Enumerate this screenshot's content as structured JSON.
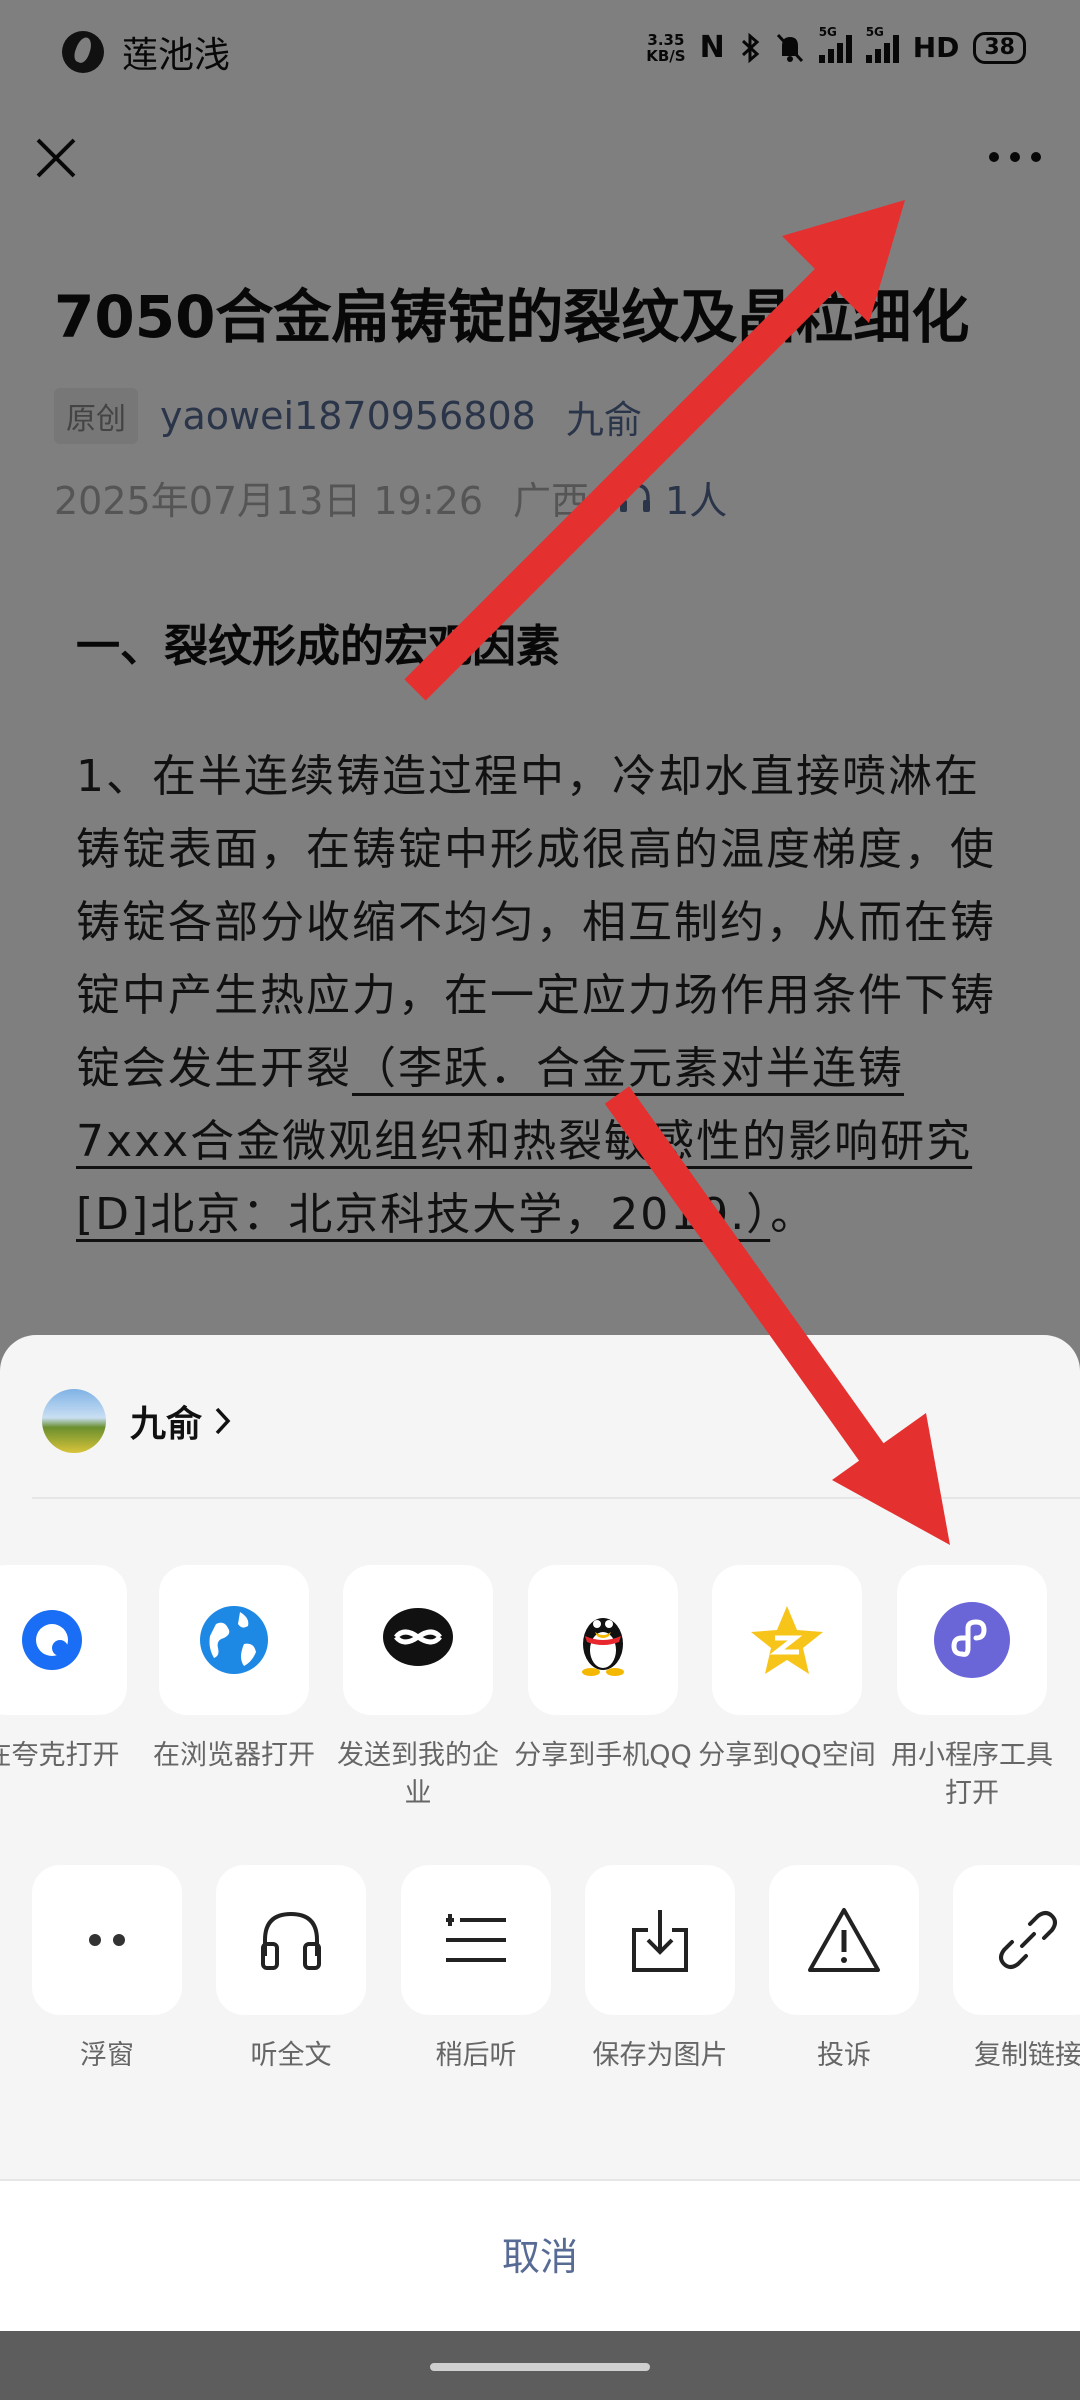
{
  "status_bar": {
    "carrier": "莲池浅",
    "speed_top": "3.35",
    "speed_bottom": "KB/S",
    "network_5g_1": "5G",
    "network_5g_2": "5G",
    "hd_label": "HD",
    "battery": "38"
  },
  "article": {
    "title": "7050合金扁铸锭的裂纹及晶粒细化",
    "badge": "原创",
    "author": "yaowei1870956808",
    "account": "九俞",
    "date": "2025年07月13日 19:26",
    "region": "广西",
    "listeners": "1人",
    "heading": "一、裂纹形成的宏观因素",
    "para_text": "1、在半连续铸造过程中，冷却水直接喷淋在铸锭表面，在铸锭中形成很高的温度梯度，使铸锭各部分收缩不均匀，相互制约，从而在铸锭中产生热应力，在一定应力场作用条件下铸锭会发生开裂",
    "citation": "（李跃．合金元素对半连铸7xxx合金微观组织和热裂敏感性的影响研究[D]北京：北京科技大学，2019.）",
    "para_end": "。"
  },
  "sheet": {
    "account_name": "九俞",
    "row1": [
      {
        "label": "在夸克打开",
        "icon": "quark-icon"
      },
      {
        "label": "在浏览器打开",
        "icon": "browser-globe-icon"
      },
      {
        "label": "发送到我的企业",
        "icon": "wecom-icon"
      },
      {
        "label": "分享到手机QQ",
        "icon": "qq-penguin-icon"
      },
      {
        "label": "分享到QQ空间",
        "icon": "qzone-star-icon"
      },
      {
        "label": "用小程序工具打开",
        "icon": "mini-program-icon"
      }
    ],
    "row2": [
      {
        "label": "浮窗",
        "icon": "floating-window-icon"
      },
      {
        "label": "听全文",
        "icon": "headphones-icon"
      },
      {
        "label": "稍后听",
        "icon": "listen-later-icon"
      },
      {
        "label": "保存为图片",
        "icon": "save-image-icon"
      },
      {
        "label": "投诉",
        "icon": "warning-icon"
      },
      {
        "label": "复制链接",
        "icon": "link-icon"
      }
    ],
    "cancel": "取消"
  },
  "colors": {
    "link_blue": "#576b95",
    "annotation_red": "#e53030",
    "sheet_bg": "#f5f5f5",
    "mini_program_purple": "#6b66d8"
  }
}
